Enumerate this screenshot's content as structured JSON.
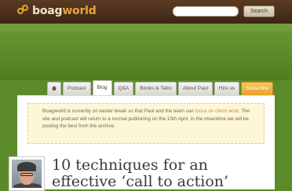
{
  "header": {
    "logo_boag": "boag",
    "logo_world": "world",
    "search_placeholder": "",
    "search_button": "Search"
  },
  "nav": {
    "tabs": [
      {
        "label": "Podcast"
      },
      {
        "label": "Blog"
      },
      {
        "label": "Q&A"
      },
      {
        "label": "Books & Talks"
      },
      {
        "label": "About Paul"
      },
      {
        "label": "Hire us"
      },
      {
        "label": "Subscribe"
      }
    ]
  },
  "notice": {
    "text_before": "Boagworld is currently on easter break so that Paul and the team can ",
    "link": "focus on client work",
    "text_after": ". The site and podcast will return to a normal publishing on the 15th April. In the meantime we will be posting the best from the archive."
  },
  "post": {
    "title": "10 techniques for an effective ‘call to action’"
  },
  "colors": {
    "header_brown": "#4a2f1a",
    "logo_orange": "#e8a33a",
    "hero_green": "#5a8a2a",
    "subscribe_orange": "#e8a22a",
    "notice_bg": "#fdf7d6"
  }
}
